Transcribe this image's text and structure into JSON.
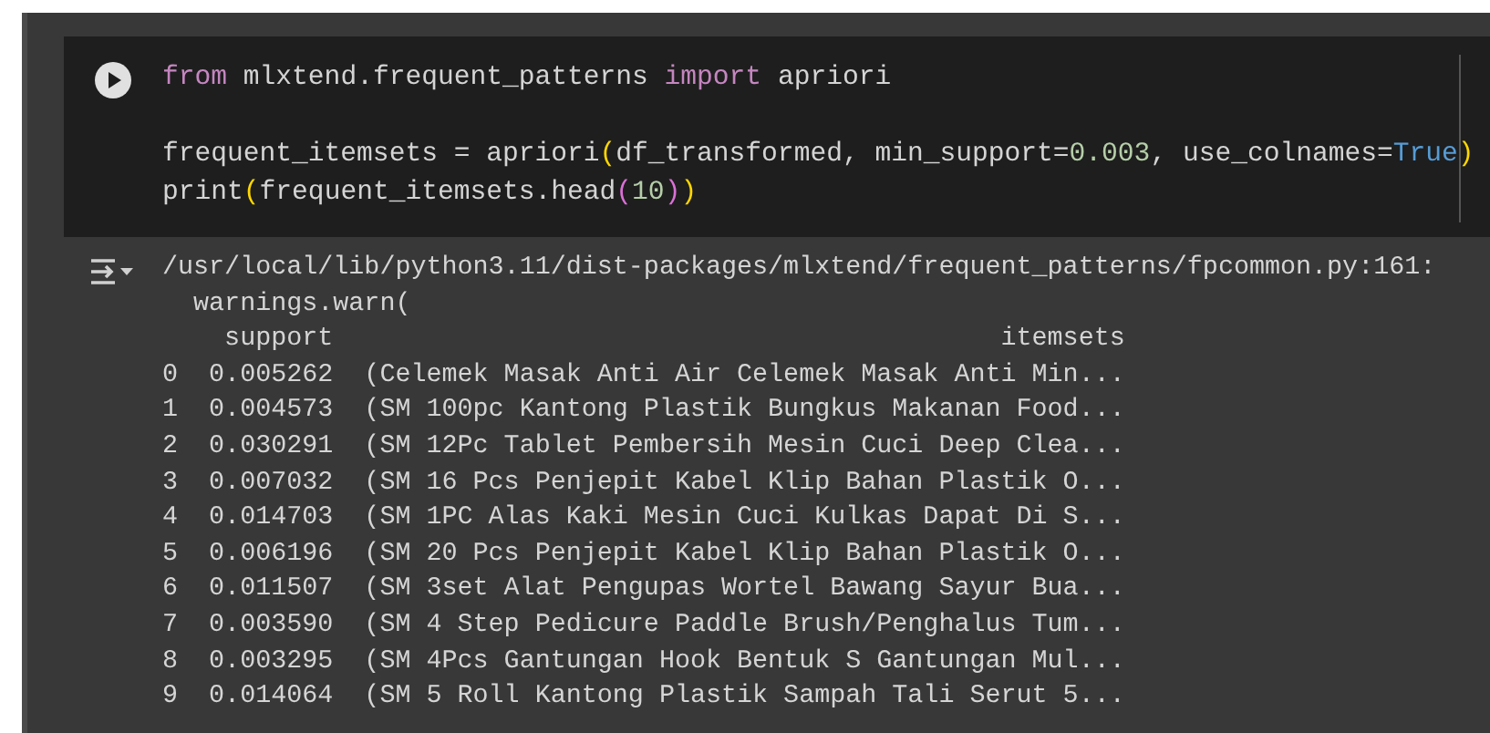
{
  "cell": {
    "code_blocks": [
      [
        [
          {
            "kind": "keyword",
            "text": "from"
          },
          {
            "kind": "plain",
            "text": " mlxtend.frequent_patterns "
          },
          {
            "kind": "keyword",
            "text": "import"
          },
          {
            "kind": "plain",
            "text": " apriori"
          }
        ]
      ],
      [
        [
          {
            "kind": "plain",
            "text": "frequent_itemsets = apriori"
          },
          {
            "kind": "paren",
            "text": "("
          },
          {
            "kind": "plain",
            "text": "df_transformed, min_support="
          },
          {
            "kind": "number",
            "text": "0.003"
          },
          {
            "kind": "plain",
            "text": ", use_colnames="
          },
          {
            "kind": "bool",
            "text": "True"
          },
          {
            "kind": "paren",
            "text": ")"
          }
        ],
        [
          {
            "kind": "plain",
            "text": "print"
          },
          {
            "kind": "paren",
            "text": "("
          },
          {
            "kind": "plain",
            "text": "frequent_itemsets.head"
          },
          {
            "kind": "paren2",
            "text": "("
          },
          {
            "kind": "number",
            "text": "10"
          },
          {
            "kind": "paren2",
            "text": ")"
          },
          {
            "kind": "paren",
            "text": ")"
          }
        ]
      ]
    ],
    "output_lines": [
      "/usr/local/lib/python3.11/dist-packages/mlxtend/frequent_patterns/fpcommon.py:161:",
      "  warnings.warn(",
      "    support                                           itemsets",
      "0  0.005262  (Celemek Masak Anti Air Celemek Masak Anti Min...",
      "1  0.004573  (SM 100pc Kantong Plastik Bungkus Makanan Food...",
      "2  0.030291  (SM 12Pc Tablet Pembersih Mesin Cuci Deep Clea...",
      "3  0.007032  (SM 16 Pcs Penjepit Kabel Klip Bahan Plastik O...",
      "4  0.014703  (SM 1PC Alas Kaki Mesin Cuci Kulkas Dapat Di S...",
      "5  0.006196  (SM 20 Pcs Penjepit Kabel Klip Bahan Plastik O...",
      "6  0.011507  (SM 3set Alat Pengupas Wortel Bawang Sayur Bua...",
      "7  0.003590  (SM 4 Step Pedicure Paddle Brush/Penghalus Tum...",
      "8  0.003295  (SM 4Pcs Gantungan Hook Bentuk S Gantungan Mul...",
      "9  0.014064  (SM 5 Roll Kantong Plastik Sampah Tali Serut 5..."
    ]
  }
}
